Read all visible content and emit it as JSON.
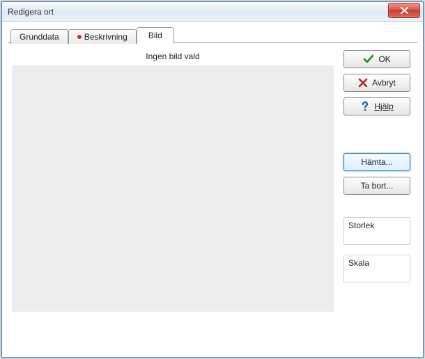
{
  "titlebar": {
    "title": "Redigera ort"
  },
  "tabs": {
    "grunddata": "Grunddata",
    "beskrivning": "Beskrivning",
    "bild": "Bild"
  },
  "main": {
    "no_image": "Ingen bild vald"
  },
  "buttons": {
    "ok": "OK",
    "cancel": "Avbryt",
    "help": "Hjälp",
    "fetch": "Hämta...",
    "remove": "Ta bort..."
  },
  "fields": {
    "size": "Storlek",
    "scale": "Skala"
  }
}
